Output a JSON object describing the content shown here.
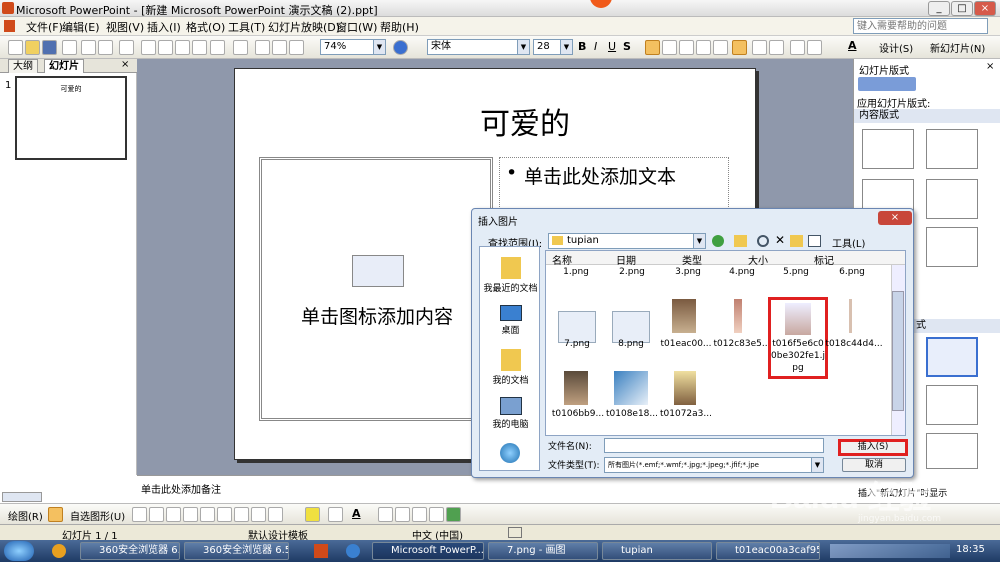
{
  "window": {
    "title": "Microsoft PowerPoint - [新建 Microsoft PowerPoint 演示文稿 (2).ppt]"
  },
  "menu": [
    "文件(F)",
    "编辑(E)",
    "视图(V)",
    "插入(I)",
    "格式(O)",
    "工具(T)",
    "幻灯片放映(D)",
    "窗口(W)",
    "帮助(H)"
  ],
  "help_box": {
    "placeholder": "键入需要帮助的问题"
  },
  "toolbar": {
    "zoom": "74%",
    "font": "宋体",
    "size": "28",
    "design": "设计(S)",
    "new_slide": "新幻灯片(N)"
  },
  "left_tabs": [
    "大纲",
    "幻灯片"
  ],
  "thumbnail": {
    "number": "1",
    "title": "可爱的"
  },
  "slide": {
    "title": "可爱的",
    "bullet": "单击此处添加文本",
    "content_placeholder": "单击图标添加内容"
  },
  "notes": "单击此处添加备注",
  "task_pane": {
    "title": "幻灯片版式",
    "apply_label": "应用幻灯片版式:",
    "section": "内容版式",
    "section2": "式",
    "footer": "插入\"新幻灯片\"时显示"
  },
  "drawbar": {
    "draw": "绘图(R)",
    "autoshape": "自选图形(U)"
  },
  "status": {
    "slide": "幻灯片 1 / 1",
    "template": "默认设计模板",
    "language": "中文 (中国)"
  },
  "taskbar": {
    "items": [
      "360安全浏览器 6.5",
      "360安全浏览器 6.5",
      "Microsoft PowerP...",
      "7.png - 画图",
      "tupian",
      "t01eac00a3caf95e..."
    ],
    "clock": "18:35"
  },
  "dialog": {
    "title": "插入图片",
    "look_in_label": "查找范围(I):",
    "folder": "tupian",
    "tools": "工具(L)",
    "places": [
      "我最近的文档",
      "桌面",
      "我的文档",
      "我的电脑"
    ],
    "columns": [
      "名称",
      "日期",
      "类型",
      "大小",
      "标记"
    ],
    "row0": [
      "1.png",
      "2.png",
      "3.png",
      "4.png",
      "5.png",
      "6.png"
    ],
    "files": [
      {
        "name": "7.png"
      },
      {
        "name": "8.png"
      },
      {
        "name": "t01eac00..."
      },
      {
        "name": "t012c83e5..."
      },
      {
        "name": "t016f5e6c00be302fe1.jpg"
      },
      {
        "name": "t018c44d4..."
      },
      {
        "name": "t0106bb9..."
      },
      {
        "name": "t0108e18..."
      },
      {
        "name": "t01072a3..."
      }
    ],
    "filename_label": "文件名(N):",
    "filetype_label": "文件类型(T):",
    "filetype_value": "所有图片(*.emf;*.wmf;*.jpg;*.jpeg;*.jfif;*.jpe",
    "insert": "插入(S)",
    "cancel": "取消"
  },
  "watermark": "Baidu 经验",
  "watermark_url": "jingyan.baidu.com"
}
